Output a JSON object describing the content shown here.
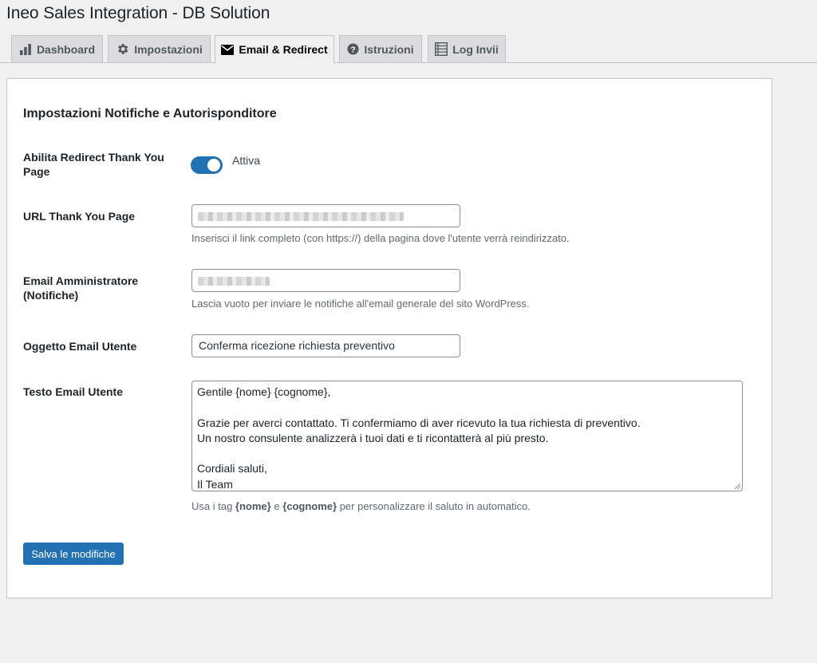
{
  "page": {
    "title": "Ineo Sales Integration - DB Solution"
  },
  "tabs": [
    {
      "label": "Dashboard",
      "icon": "bar-chart-icon"
    },
    {
      "label": "Impostazioni",
      "icon": "gear-icon"
    },
    {
      "label": "Email & Redirect",
      "icon": "envelope-icon",
      "active": true
    },
    {
      "label": "Istruzioni",
      "icon": "help-circle-icon"
    },
    {
      "label": "Log Invii",
      "icon": "list-table-icon"
    }
  ],
  "section": {
    "title": "Impostazioni Notifiche e Autorisponditore"
  },
  "fields": {
    "redirect": {
      "label": "Abilita Redirect Thank You Page",
      "toggle_label": "Attiva",
      "enabled": true
    },
    "thankyou_url": {
      "label": "URL Thank You Page",
      "value_redacted": true,
      "description": "Inserisci il link completo (con https://) della pagina dove l'utente verrà reindirizzato."
    },
    "admin_email": {
      "label": "Email Amministratore (Notifiche)",
      "value_redacted": true,
      "description": "Lascia vuoto per inviare le notifiche all'email generale del sito WordPress."
    },
    "user_subject": {
      "label": "Oggetto Email Utente",
      "value": "Conferma ricezione richiesta preventivo"
    },
    "user_body": {
      "label": "Testo Email Utente",
      "value": "Gentile {nome} {cognome},\n\nGrazie per averci contattato. Ti confermiamo di aver ricevuto la tua richiesta di preventivo.\nUn nostro consulente analizzerà i tuoi dati e ti ricontatterà al più presto.\n\nCordiali saluti,\nIl Team",
      "help_prefix": "Usa i tag ",
      "help_tag1": "{nome}",
      "help_mid": " e ",
      "help_tag2": "{cognome}",
      "help_suffix": " per personalizzare il saluto in automatico."
    }
  },
  "actions": {
    "save_label": "Salva le modifiche"
  },
  "colors": {
    "accent": "#2271b1",
    "background": "#f0f0f1",
    "card": "#ffffff"
  }
}
